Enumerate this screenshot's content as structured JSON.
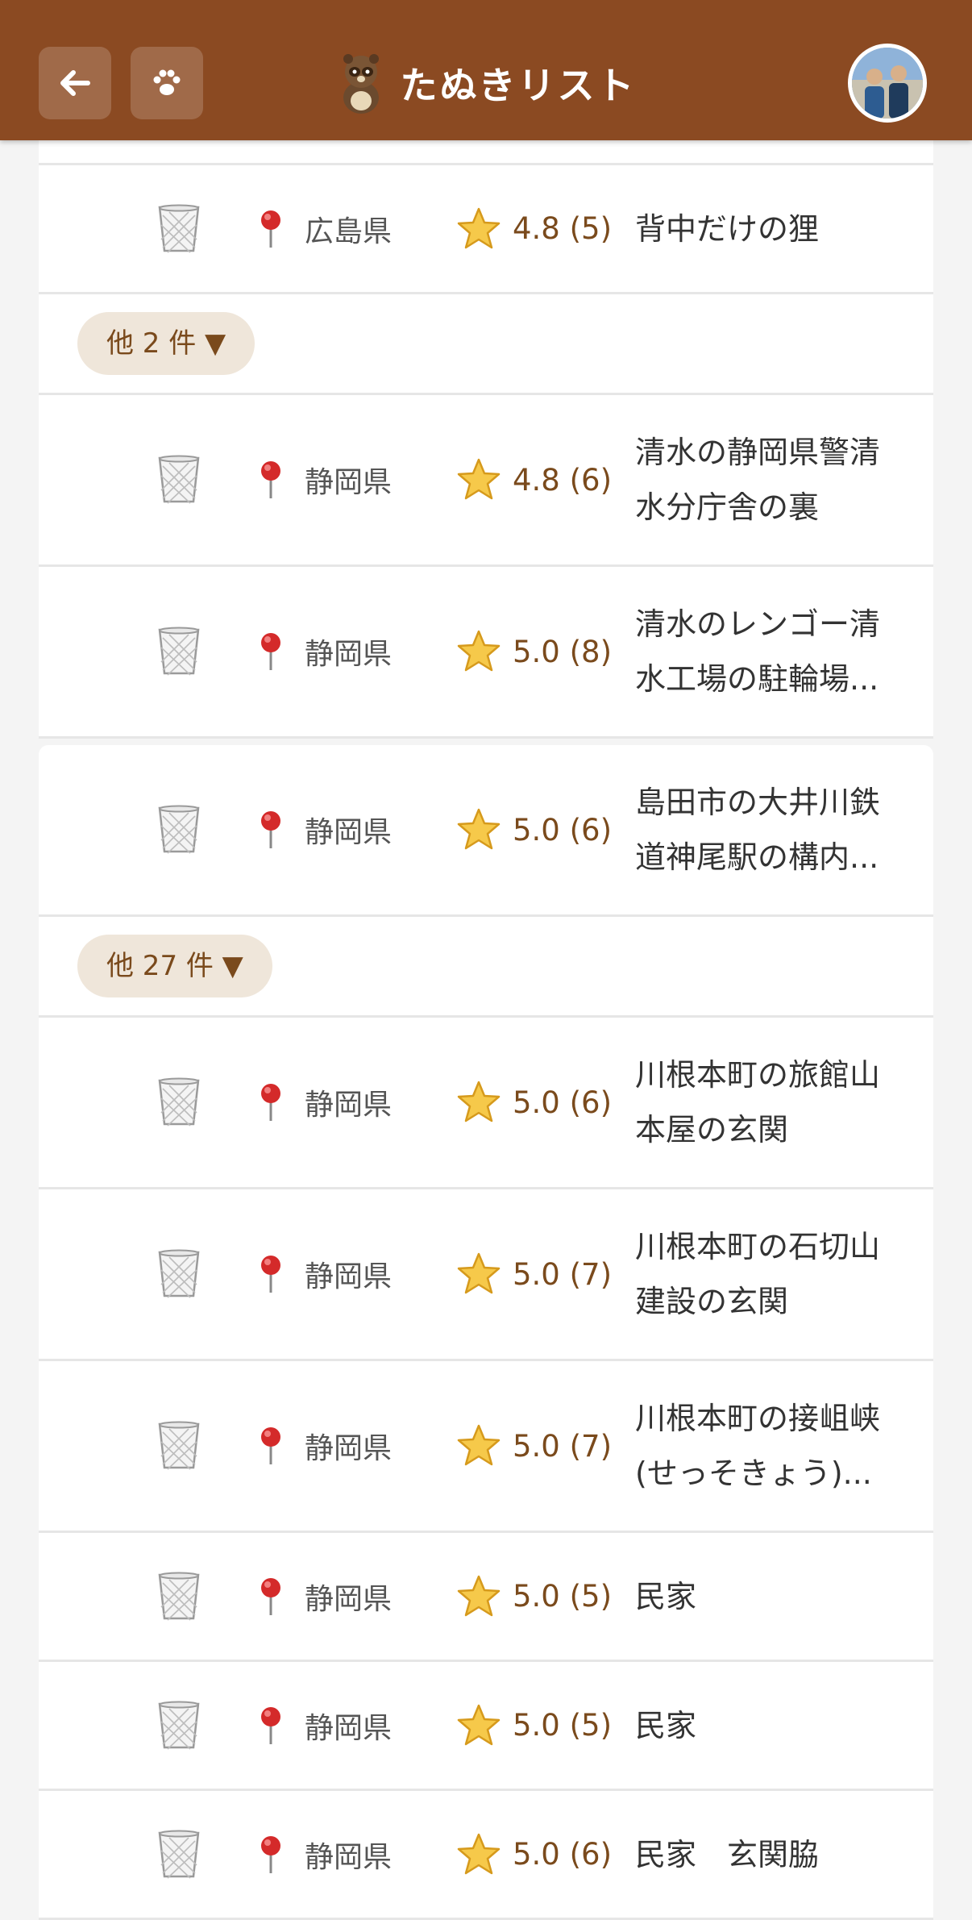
{
  "header": {
    "title": "たぬきリスト",
    "back_icon": "arrow-left-icon",
    "paw_icon": "paw-icon",
    "colors": {
      "bar": "#8b4a22",
      "accent": "#7a4a1c"
    }
  },
  "rows": [
    {
      "prefecture": "広島県",
      "rating": "4.8 (5)",
      "name_lines": [
        "背中だけの狸",
        ""
      ]
    },
    {
      "more": "他 2 件 ▼"
    },
    {
      "prefecture": "静岡県",
      "rating": "4.8 (6)",
      "name_lines": [
        "清水の静岡県警清",
        "水分庁舎の裏"
      ]
    },
    {
      "prefecture": "静岡県",
      "rating": "5.0 (8)",
      "name_lines": [
        "清水のレンゴー清",
        "水工場の駐輪場..."
      ]
    },
    {
      "prefecture": "静岡県",
      "rating": "5.0 (6)",
      "name_lines": [
        "島田市の大井川鉄",
        "道神尾駅の構内..."
      ]
    },
    {
      "more": "他 27 件 ▼"
    },
    {
      "prefecture": "静岡県",
      "rating": "5.0 (6)",
      "name_lines": [
        "川根本町の旅館山",
        "本屋の玄関"
      ]
    },
    {
      "prefecture": "静岡県",
      "rating": "5.0 (7)",
      "name_lines": [
        "川根本町の石切山",
        "建設の玄関"
      ]
    },
    {
      "prefecture": "静岡県",
      "rating": "5.0 (7)",
      "name_lines": [
        "川根本町の接岨峡",
        "(せっそきょう)..."
      ]
    },
    {
      "prefecture": "静岡県",
      "rating": "5.0 (5)",
      "name_lines": [
        "民家",
        ""
      ]
    },
    {
      "prefecture": "静岡県",
      "rating": "5.0 (5)",
      "name_lines": [
        "民家",
        ""
      ]
    },
    {
      "prefecture": "静岡県",
      "rating": "5.0 (6)",
      "name_lines": [
        "民家　玄関脇",
        ""
      ]
    }
  ]
}
